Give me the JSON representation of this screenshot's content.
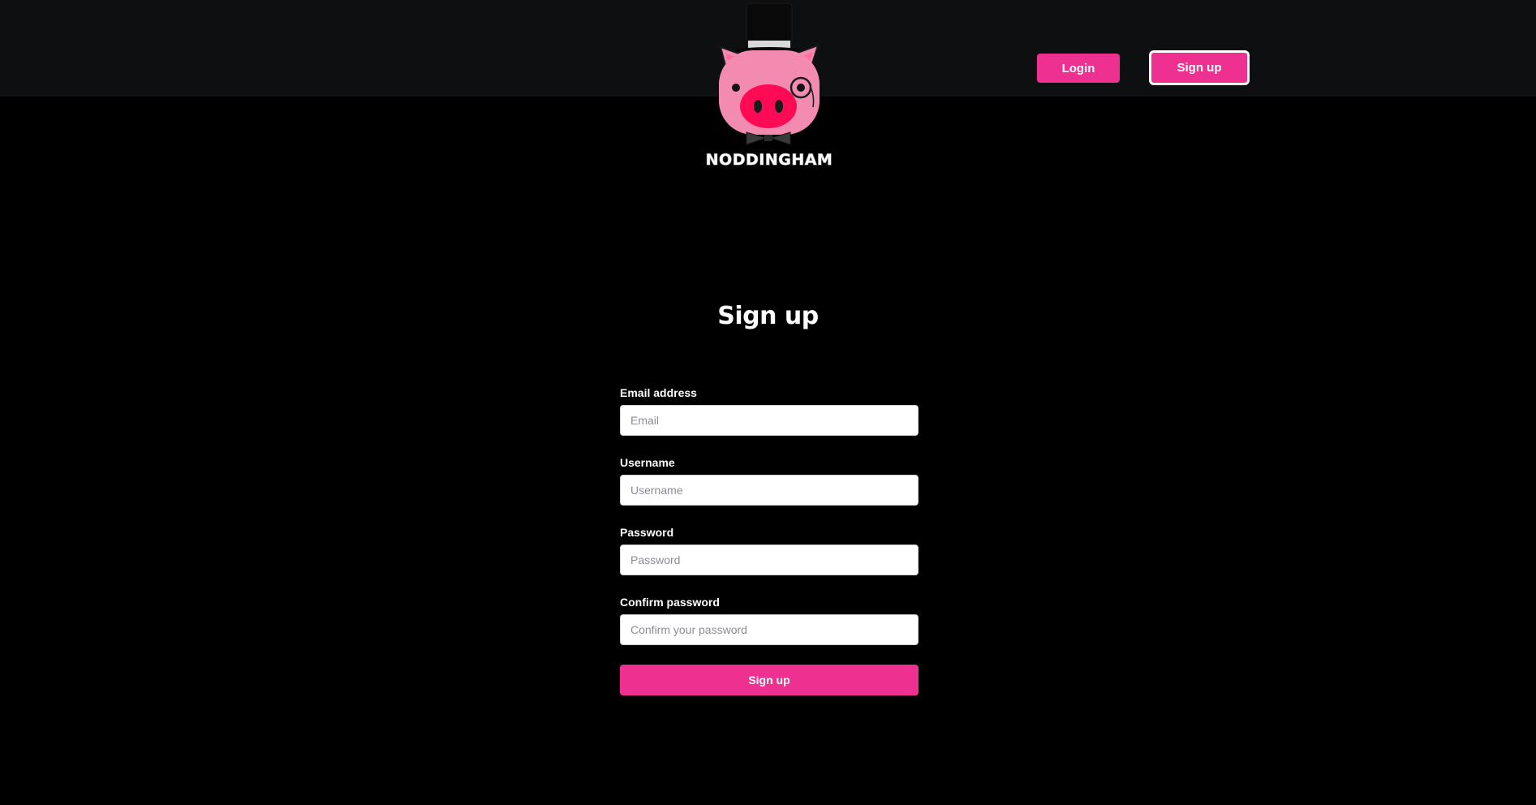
{
  "brand": {
    "name": "NODDINGHAM"
  },
  "nav": {
    "login_label": "Login",
    "signup_label": "Sign up"
  },
  "form": {
    "title": "Sign up",
    "fields": [
      {
        "label": "Email address",
        "placeholder": "Email",
        "value": ""
      },
      {
        "label": "Username",
        "placeholder": "Username",
        "value": ""
      },
      {
        "label": "Password",
        "placeholder": "Password",
        "value": ""
      },
      {
        "label": "Confirm password",
        "placeholder": "Confirm your password",
        "value": ""
      }
    ],
    "submit_label": "Sign up"
  },
  "colors": {
    "accent": "#ee3190",
    "header_bg": "#0e0f11",
    "page_bg": "#000000",
    "pig_pink": "#f38bb0",
    "pig_snout": "#ff0a54"
  },
  "icons": {
    "logo": "pig-with-top-hat-and-monocle-icon"
  }
}
